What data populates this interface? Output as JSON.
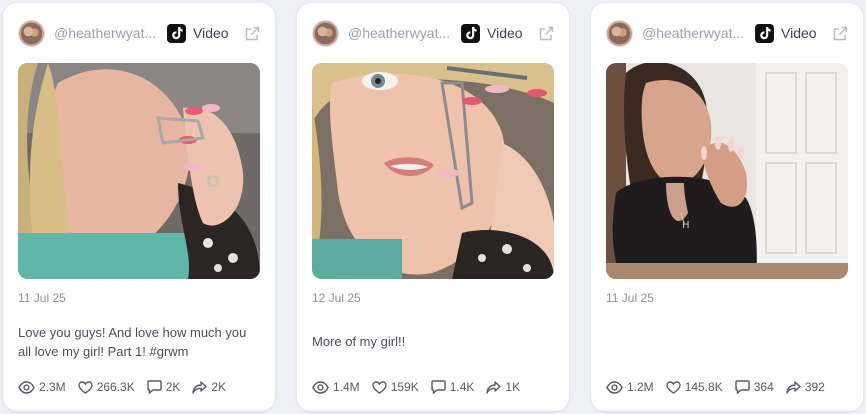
{
  "cards": [
    {
      "handle": "@heatherwyat...",
      "type_label": "Video",
      "platform_icon": "tiktok-icon",
      "date": "11 Jul 25",
      "caption": "Love you guys! And love how much you all love my girl! Part 1! #grwm",
      "stats": {
        "views": "2.3M",
        "likes": "266.3K",
        "comments": "2K",
        "shares": "2K"
      }
    },
    {
      "handle": "@heatherwyat...",
      "type_label": "Video",
      "platform_icon": "tiktok-icon",
      "date": "12 Jul 25",
      "caption": "More of my girl!!",
      "stats": {
        "views": "1.4M",
        "likes": "159K",
        "comments": "1.4K",
        "shares": "1K"
      }
    },
    {
      "handle": "@heatherwyat...",
      "type_label": "Video",
      "platform_icon": "tiktok-icon",
      "date": "11 Jul 25",
      "caption": "",
      "stats": {
        "views": "1.2M",
        "likes": "145.8K",
        "comments": "364",
        "shares": "392"
      }
    }
  ]
}
